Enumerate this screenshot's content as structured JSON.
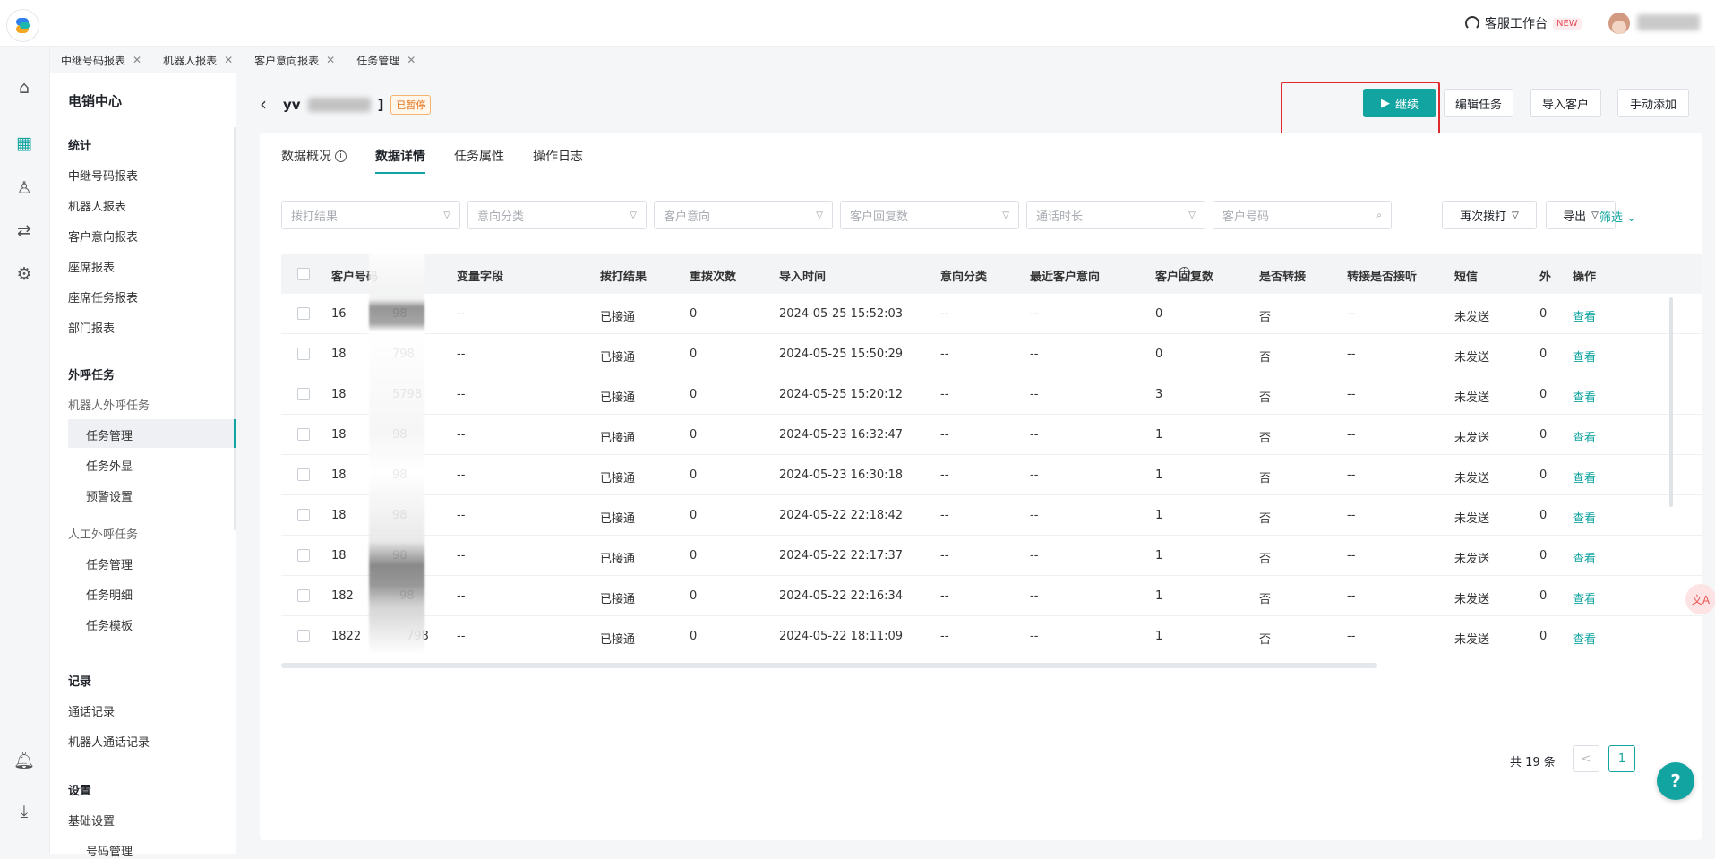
{
  "header": {
    "workspace_label": "客服工作台",
    "new_badge": "NEW"
  },
  "open_tabs": [
    {
      "label": "中继号码报表"
    },
    {
      "label": "机器人报表"
    },
    {
      "label": "客户意向报表"
    },
    {
      "label": "任务管理"
    }
  ],
  "sidebar": {
    "title": "电销中心",
    "stats_heading": "统计",
    "stats_items": [
      "中继号码报表",
      "机器人报表",
      "客户意向报表",
      "座席报表",
      "座席任务报表",
      "部门报表"
    ],
    "outbound_heading": "外呼任务",
    "robot_group": "机器人外呼任务",
    "robot_items": [
      "任务管理",
      "任务外显",
      "预警设置"
    ],
    "manual_group": "人工外呼任务",
    "manual_items": [
      "任务管理",
      "任务明细",
      "任务模板"
    ],
    "records_heading": "记录",
    "records_items": [
      "通话记录",
      "机器人通话记录"
    ],
    "settings_heading": "设置",
    "settings_items": [
      "基础设置",
      "号码管理"
    ]
  },
  "task": {
    "title_prefix": "yv",
    "title_suffix": "]",
    "status": "已暂停"
  },
  "actions": {
    "continue": "继续",
    "edit": "编辑任务",
    "import": "导入客户",
    "manual_add": "手动添加"
  },
  "detail_tabs": [
    {
      "label": "数据概况"
    },
    {
      "label": "数据详情"
    },
    {
      "label": "任务属性"
    },
    {
      "label": "操作日志"
    }
  ],
  "filters": {
    "dial_result": "拨打结果",
    "intent_category": "意向分类",
    "customer_intent": "客户意向",
    "reply_count": "客户回复数",
    "call_duration": "通话时长",
    "customer_number": "客户号码"
  },
  "tools": {
    "redial": "再次拨打",
    "export": "导出",
    "screen": "筛选"
  },
  "table": {
    "headers": [
      "客户号码",
      "变量字段",
      "拨打结果",
      "重拨次数",
      "导入时间",
      "意向分类",
      "最近客户意向",
      "客户回复数",
      "是否转接",
      "转接是否接听",
      "短信",
      "外",
      "操作"
    ],
    "rows": [
      [
        "16",
        "98",
        "--",
        "已接通",
        "0",
        "2024-05-25 15:52:03",
        "--",
        "--",
        "0",
        "否",
        "--",
        "未发送",
        "0",
        "查看"
      ],
      [
        "18",
        "798",
        "--",
        "已接通",
        "0",
        "2024-05-25 15:50:29",
        "--",
        "--",
        "0",
        "否",
        "--",
        "未发送",
        "0",
        "查看"
      ],
      [
        "18",
        "5798",
        "--",
        "已接通",
        "0",
        "2024-05-25 15:20:12",
        "--",
        "--",
        "3",
        "否",
        "--",
        "未发送",
        "0",
        "查看"
      ],
      [
        "18",
        "98",
        "--",
        "已接通",
        "0",
        "2024-05-23 16:32:47",
        "--",
        "--",
        "1",
        "否",
        "--",
        "未发送",
        "0",
        "查看"
      ],
      [
        "18",
        "98",
        "--",
        "已接通",
        "0",
        "2024-05-23 16:30:18",
        "--",
        "--",
        "1",
        "否",
        "--",
        "未发送",
        "0",
        "查看"
      ],
      [
        "18",
        "98",
        "--",
        "已接通",
        "0",
        "2024-05-22 22:18:42",
        "--",
        "--",
        "1",
        "否",
        "--",
        "未发送",
        "0",
        "查看"
      ],
      [
        "18",
        "98",
        "--",
        "已接通",
        "0",
        "2024-05-22 22:17:37",
        "--",
        "--",
        "1",
        "否",
        "--",
        "未发送",
        "0",
        "查看"
      ],
      [
        "182",
        "98",
        "--",
        "已接通",
        "0",
        "2024-05-22 22:16:34",
        "--",
        "--",
        "1",
        "否",
        "--",
        "未发送",
        "0",
        "查看"
      ],
      [
        "1822",
        "798",
        "--",
        "已接通",
        "0",
        "2024-05-22 18:11:09",
        "--",
        "--",
        "1",
        "否",
        "--",
        "未发送",
        "0",
        "查看"
      ]
    ]
  },
  "pagination": {
    "total": "共 19 条",
    "prev": "<",
    "page": "1"
  },
  "colors": {
    "accent": "#12a4a0",
    "highlight": "#e0292c",
    "paused": "#e37318"
  }
}
